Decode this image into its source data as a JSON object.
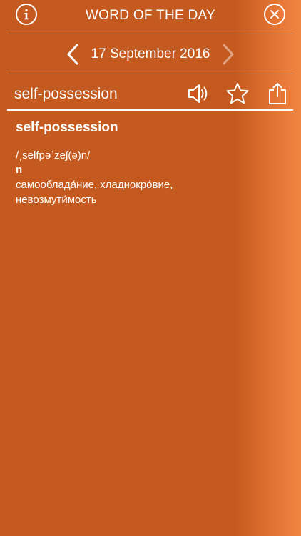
{
  "header": {
    "title": "WORD OF THE DAY",
    "info_icon": "info-icon",
    "close_icon": "close-icon"
  },
  "date_nav": {
    "date": "17 September 2016",
    "prev_icon": "chevron-left-icon",
    "next_icon": "chevron-right-icon"
  },
  "word_bar": {
    "word": "self-possession",
    "icons": [
      "speaker-icon",
      "star-icon",
      "share-icon"
    ]
  },
  "entry": {
    "word": "self-possession",
    "pronunciation": "/ˌselfpəˈzeʃ(ə)n/",
    "part_of_speech": "n",
    "translation_line1": "самооблада́ние, хладнокро́вие,",
    "translation_line2": "невозмути́мость"
  },
  "colors": {
    "background": "#c45a1f",
    "side_glow": "#f08642",
    "text": "#ffffff"
  }
}
